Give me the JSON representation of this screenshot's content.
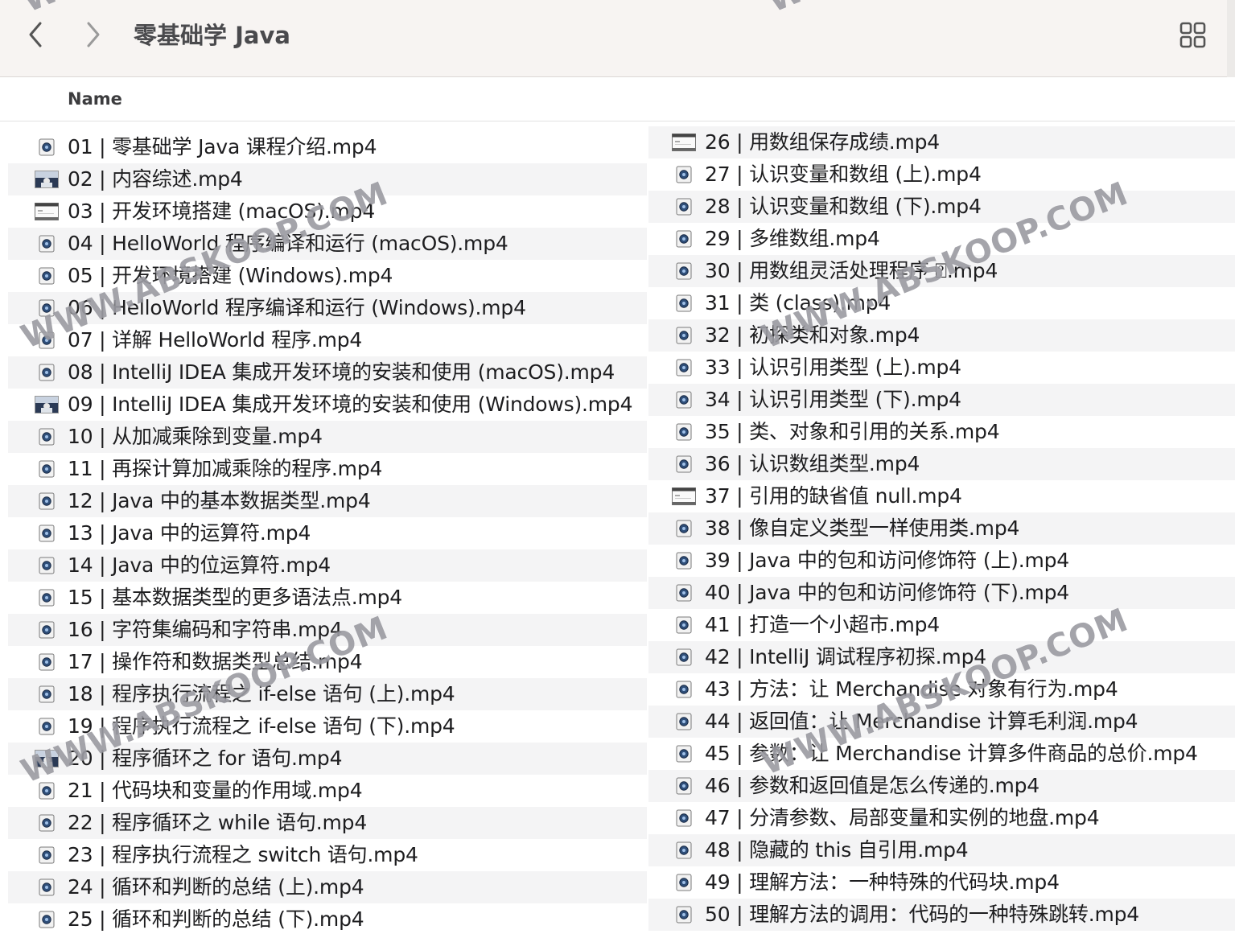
{
  "window": {
    "title": "零基础学 Java",
    "back_icon": "chevron-left-icon",
    "forward_icon": "chevron-right-icon",
    "view_icon": "grid-view-icon"
  },
  "list_header": {
    "name": "Name"
  },
  "files_left": [
    {
      "label": "01 | 零基础学 Java 课程介绍.mp4",
      "thumb": "video"
    },
    {
      "label": "02 | 内容综述.mp4",
      "thumb": "photo"
    },
    {
      "label": "03 | 开发环境搭建 (macOS).mp4",
      "thumb": "doc"
    },
    {
      "label": "04 | HelloWorld 程序编译和运行 (macOS).mp4",
      "thumb": "video"
    },
    {
      "label": "05 | 开发环境搭建 (Windows).mp4",
      "thumb": "video"
    },
    {
      "label": "06 | HelloWorld 程序编译和运行 (Windows).mp4",
      "thumb": "video"
    },
    {
      "label": "07 | 详解 HelloWorld 程序.mp4",
      "thumb": "video"
    },
    {
      "label": "08 | IntelliJ IDEA 集成开发环境的安装和使用 (macOS).mp4",
      "thumb": "video"
    },
    {
      "label": "09 | IntelliJ IDEA 集成开发环境的安装和使用 (Windows).mp4",
      "thumb": "photo"
    },
    {
      "label": "10 | 从加减乘除到变量.mp4",
      "thumb": "video"
    },
    {
      "label": "11 | 再探计算加减乘除的程序.mp4",
      "thumb": "video"
    },
    {
      "label": "12 | Java 中的基本数据类型.mp4",
      "thumb": "video"
    },
    {
      "label": "13 | Java 中的运算符.mp4",
      "thumb": "video"
    },
    {
      "label": "14 | Java 中的位运算符.mp4",
      "thumb": "video"
    },
    {
      "label": "15 | 基本数据类型的更多语法点.mp4",
      "thumb": "video"
    },
    {
      "label": "16 | 字符集编码和字符串.mp4",
      "thumb": "video"
    },
    {
      "label": "17 | 操作符和数据类型总结.mp4",
      "thumb": "video"
    },
    {
      "label": "18 | 程序执行流程之 if-else 语句 (上).mp4",
      "thumb": "video"
    },
    {
      "label": "19 | 程序执行流程之 if-else 语句 (下).mp4",
      "thumb": "video"
    },
    {
      "label": "20 | 程序循环之 for 语句.mp4",
      "thumb": "photo"
    },
    {
      "label": "21 | 代码块和变量的作用域.mp4",
      "thumb": "video"
    },
    {
      "label": "22 | 程序循环之 while 语句.mp4",
      "thumb": "video"
    },
    {
      "label": "23 | 程序执行流程之 switch 语句.mp4",
      "thumb": "video"
    },
    {
      "label": "24 | 循环和判断的总结 (上).mp4",
      "thumb": "video"
    },
    {
      "label": "25 | 循环和判断的总结 (下).mp4",
      "thumb": "video"
    }
  ],
  "files_right": [
    {
      "label": "26 | 用数组保存成绩.mp4",
      "thumb": "doc"
    },
    {
      "label": "27 | 认识变量和数组 (上).mp4",
      "thumb": "video"
    },
    {
      "label": "28 | 认识变量和数组 (下).mp4",
      "thumb": "video"
    },
    {
      "label": "29 | 多维数组.mp4",
      "thumb": "video"
    },
    {
      "label": "30 | 用数组灵活处理程序 ⍰.mp4",
      "thumb": "video"
    },
    {
      "label": "31 | 类 (class).mp4",
      "thumb": "video"
    },
    {
      "label": "32 | 初探类和对象.mp4",
      "thumb": "video"
    },
    {
      "label": "33 | 认识引用类型 (上).mp4",
      "thumb": "video"
    },
    {
      "label": "34 | 认识引用类型 (下).mp4",
      "thumb": "video"
    },
    {
      "label": "35 | 类、对象和引用的关系.mp4",
      "thumb": "video"
    },
    {
      "label": "36 | 认识数组类型.mp4",
      "thumb": "video"
    },
    {
      "label": "37 | 引用的缺省值 null.mp4",
      "thumb": "doc"
    },
    {
      "label": "38 | 像自定义类型一样使用类.mp4",
      "thumb": "video"
    },
    {
      "label": "39 | Java 中的包和访问修饰符 (上).mp4",
      "thumb": "video"
    },
    {
      "label": "40 | Java 中的包和访问修饰符 (下).mp4",
      "thumb": "video"
    },
    {
      "label": "41 | 打造一个小超市.mp4",
      "thumb": "video"
    },
    {
      "label": "42 | IntelliJ 调试程序初探.mp4",
      "thumb": "video"
    },
    {
      "label": "43 | 方法：让 Merchandise 对象有行为.mp4",
      "thumb": "video"
    },
    {
      "label": "44 | 返回值：让 Merchandise 计算毛利润.mp4",
      "thumb": "video"
    },
    {
      "label": "45 | 参数：让 Merchandise 计算多件商品的总价.mp4",
      "thumb": "video"
    },
    {
      "label": "46 | 参数和返回值是怎么传递的.mp4",
      "thumb": "video"
    },
    {
      "label": "47 | 分清参数、局部变量和实例的地盘.mp4",
      "thumb": "video"
    },
    {
      "label": "48 | 隐藏的 this 自引用.mp4",
      "thumb": "video"
    },
    {
      "label": "49 | 理解方法：一种特殊的代码块.mp4",
      "thumb": "video"
    },
    {
      "label": "50 | 理解方法的调用：代码的一种特殊跳转.mp4",
      "thumb": "video"
    }
  ],
  "watermarks": [
    "WWW.ABSKOOP.COM",
    "WWW.ABSKOOP.COM",
    "WWW.ABSKOOP.COM",
    "WWW.ABSKOOP.COM",
    "WWW",
    "WWW"
  ],
  "colors": {
    "toolbar_bg": "#f7f4f2",
    "row_alt": "#f4f4f5",
    "text": "#1d1d1f",
    "title_text": "#4a4a4d"
  }
}
